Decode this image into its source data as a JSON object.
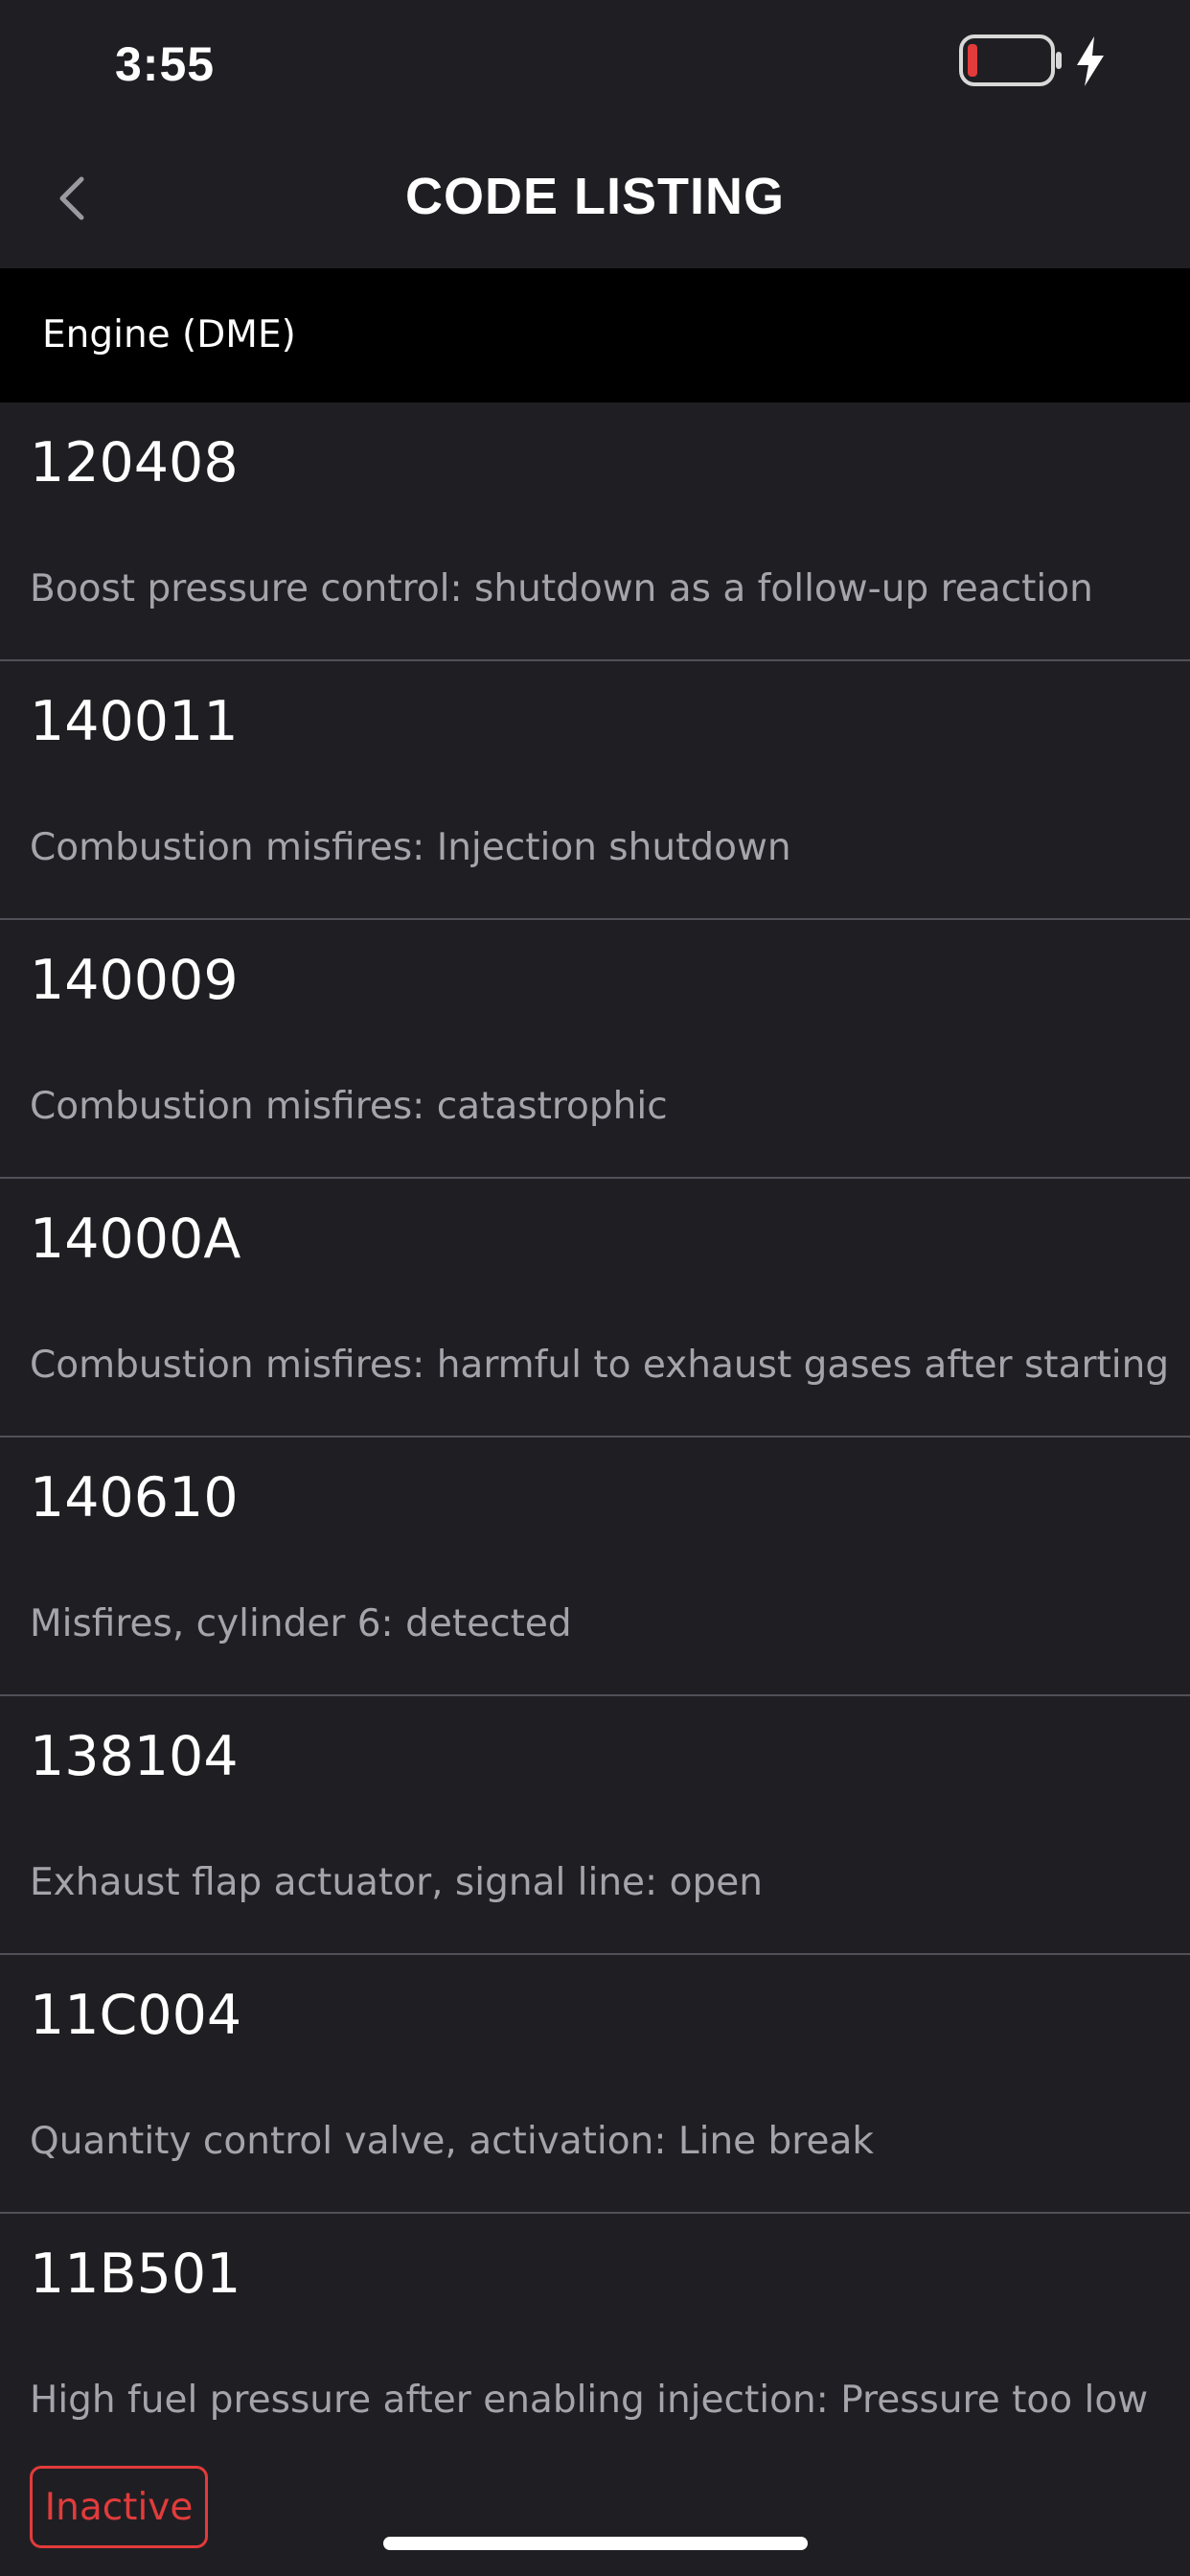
{
  "status_bar": {
    "time": "3:55",
    "battery_color": "#e23b3b"
  },
  "nav": {
    "back_icon": "chevron-left-icon",
    "title": "CODE LISTING"
  },
  "section": {
    "header": "Engine (DME)"
  },
  "codes": [
    {
      "code": "120408",
      "description": "Boost pressure control: shutdown as a follow-up reaction"
    },
    {
      "code": "140011",
      "description": "Combustion misfires: Injection shutdown"
    },
    {
      "code": "140009",
      "description": "Combustion misfires: catastrophic"
    },
    {
      "code": "14000A",
      "description": "Combustion misfires: harmful to exhaust gases after starting"
    },
    {
      "code": "140610",
      "description": "Misfires, cylinder 6: detected"
    },
    {
      "code": "138104",
      "description": "Exhaust flap actuator, signal line: open"
    },
    {
      "code": "11C004",
      "description": "Quantity control valve, activation: Line break"
    },
    {
      "code": "11B501",
      "description": "High fuel pressure after enabling injection: Pressure too low"
    }
  ],
  "badge": {
    "label": "Inactive",
    "color": "#e23b3b"
  }
}
